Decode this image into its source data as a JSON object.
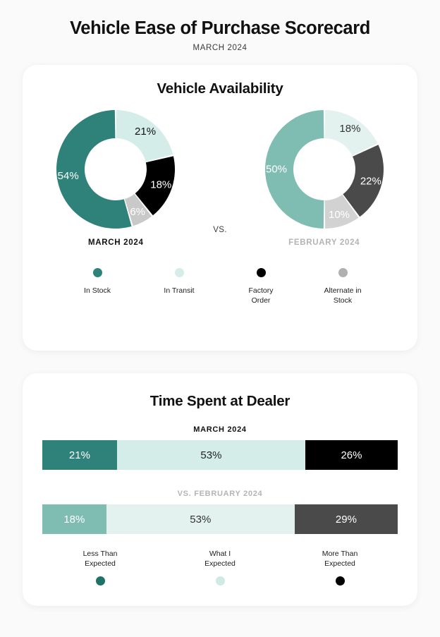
{
  "header": {
    "title": "Vehicle Ease of Purchase Scorecard",
    "subtitle": "MARCH 2024"
  },
  "colors": {
    "teal": "#2f8279",
    "mint": "#d5ede9",
    "black": "#000000",
    "grey": "#c9c9c9",
    "sage": "#7fbdb2",
    "pale_mint": "#e4f2ef",
    "dark_grey": "#4a4a4a",
    "light_grey": "#d2d2d2",
    "caption_prior": "#b4b4b4"
  },
  "availability": {
    "title": "Vehicle Availability",
    "vs_label": "VS.",
    "current_caption": "MARCH 2024",
    "prior_caption": "FEBRUARY 2024",
    "legend": [
      {
        "label": "In Stock",
        "color": "#2f8279"
      },
      {
        "label": "In Transit",
        "color": "#d5ede9"
      },
      {
        "label": "Factory\nOrder",
        "color": "#000000"
      },
      {
        "label": "Alternate in\nStock",
        "color": "#b0b0b0"
      }
    ]
  },
  "time_at_dealer": {
    "title": "Time Spent at Dealer",
    "current_caption": "MARCH 2024",
    "prior_caption": "VS. FEBRUARY 2024",
    "legend": [
      {
        "label": "Less Than\nExpected",
        "color": "#1e7366"
      },
      {
        "label": "What I\nExpected",
        "color": "#cfe9e4"
      },
      {
        "label": "More Than\nExpected",
        "color": "#000000"
      }
    ]
  },
  "chart_data": [
    {
      "type": "pie",
      "title": "Vehicle Availability",
      "subtitle": "MARCH 2024",
      "categories": [
        "In Transit",
        "Factory Order",
        "Alternate in Stock",
        "In Stock"
      ],
      "values": [
        21,
        18,
        6,
        54
      ],
      "labels": [
        "21%",
        "18%",
        "6%",
        "54%"
      ],
      "colors": [
        "#d5ede9",
        "#000000",
        "#c9c9c9",
        "#2f8279"
      ],
      "label_colors": [
        "#111111",
        "#ffffff",
        "#ffffff",
        "#ffffff"
      ],
      "donut": true,
      "start_angle": 0,
      "legend_position": "bottom"
    },
    {
      "type": "pie",
      "title": "Vehicle Availability",
      "subtitle": "FEBRUARY 2024",
      "categories": [
        "In Transit",
        "Factory Order",
        "Alternate in Stock",
        "In Stock"
      ],
      "values": [
        18,
        22,
        10,
        50
      ],
      "labels": [
        "18%",
        "22%",
        "10%",
        "50%"
      ],
      "colors": [
        "#e4f2ef",
        "#4a4a4a",
        "#d2d2d2",
        "#7fbdb2"
      ],
      "label_colors": [
        "#333333",
        "#ffffff",
        "#ffffff",
        "#ffffff"
      ],
      "donut": true,
      "start_angle": 0,
      "legend_position": "bottom"
    },
    {
      "type": "bar",
      "orientation": "horizontal-stacked",
      "title": "Time Spent at Dealer",
      "subtitle": "MARCH 2024",
      "categories": [
        "Less Than Expected",
        "What I Expected",
        "More Than Expected"
      ],
      "values": [
        21,
        53,
        26
      ],
      "labels": [
        "21%",
        "53%",
        "26%"
      ],
      "colors": [
        "#2f8279",
        "#d5ede9",
        "#000000"
      ],
      "label_colors": [
        "#ffffff",
        "#222222",
        "#ffffff"
      ],
      "xlim": [
        0,
        100
      ]
    },
    {
      "type": "bar",
      "orientation": "horizontal-stacked",
      "title": "Time Spent at Dealer",
      "subtitle": "VS. FEBRUARY 2024",
      "categories": [
        "Less Than Expected",
        "What I Expected",
        "More Than Expected"
      ],
      "values": [
        18,
        53,
        29
      ],
      "labels": [
        "18%",
        "53%",
        "29%"
      ],
      "colors": [
        "#7fbdb2",
        "#e4f2ef",
        "#4a4a4a"
      ],
      "label_colors": [
        "#ffffff",
        "#333333",
        "#ffffff"
      ],
      "xlim": [
        0,
        100
      ]
    }
  ]
}
